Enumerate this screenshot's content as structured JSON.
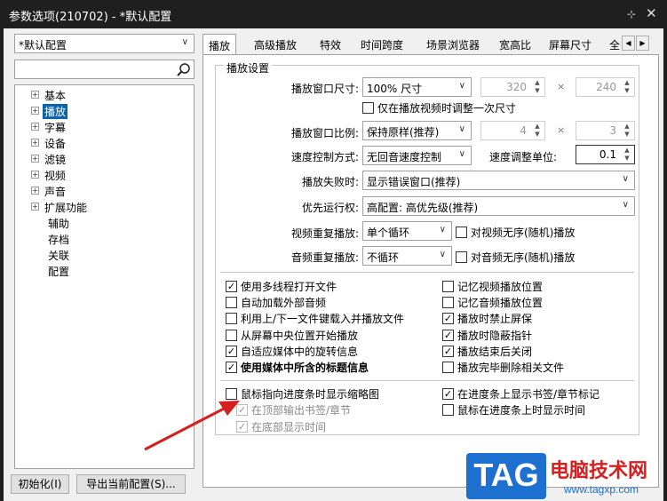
{
  "window": {
    "title": "参数选项(210702) - *默认配置",
    "pin_glyph": "⊹",
    "close_glyph": "✕"
  },
  "left": {
    "profile": "*默认配置",
    "search_placeholder": "",
    "tree": [
      {
        "label": "基本",
        "expandable": true
      },
      {
        "label": "播放",
        "expandable": true,
        "selected": true
      },
      {
        "label": "字幕",
        "expandable": true
      },
      {
        "label": "设备",
        "expandable": true
      },
      {
        "label": "滤镜",
        "expandable": true
      },
      {
        "label": "视频",
        "expandable": true
      },
      {
        "label": "声音",
        "expandable": true
      },
      {
        "label": "扩展功能",
        "expandable": true
      },
      {
        "label": "辅助",
        "expandable": false
      },
      {
        "label": "存档",
        "expandable": false
      },
      {
        "label": "关联",
        "expandable": false
      },
      {
        "label": "配置",
        "expandable": false
      }
    ]
  },
  "tabs": [
    "播放",
    "高级播放",
    "特效",
    "时间跨度",
    "场景浏览器",
    "宽高比",
    "屏幕尺寸",
    "全"
  ],
  "tab_scroll": {
    "left": "◀",
    "right": "▶"
  },
  "group": {
    "title": "播放设置",
    "window_size_label": "播放窗口尺寸:",
    "window_size_value": "100% 尺寸",
    "width_value": "320",
    "height_value": "240",
    "times": "×",
    "resize_once_label": "仅在播放视频时调整一次尺寸",
    "ratio_label": "播放窗口比例:",
    "ratio_value": "保持原样(推荐)",
    "ratio_w": "4",
    "ratio_h": "3",
    "speed_mode_label": "速度控制方式:",
    "speed_mode_value": "无回音速度控制",
    "speed_unit_label": "速度调整单位:",
    "speed_unit_value": "0.1",
    "fail_label": "播放失败时:",
    "fail_value": "显示错误窗口(推荐)",
    "priority_label": "优先运行权:",
    "priority_value": "高配置: 高优先级(推荐)",
    "video_repeat_label": "视频重复播放:",
    "video_repeat_value": "单个循环",
    "video_random_label": "对视频无序(随机)播放",
    "audio_repeat_label": "音频重复播放:",
    "audio_repeat_value": "不循环",
    "audio_random_label": "对音频无序(随机)播放"
  },
  "checks_left": [
    {
      "label": "使用多线程打开文件",
      "checked": true
    },
    {
      "label": "自动加载外部音频",
      "checked": false
    },
    {
      "label": "利用上/下一文件键载入并播放文件",
      "checked": false
    },
    {
      "label": "从屏幕中央位置开始播放",
      "checked": false
    },
    {
      "label": "自适应媒体中的旋转信息",
      "checked": true
    },
    {
      "label": "使用媒体中所含的标题信息",
      "checked": true
    }
  ],
  "checks_right": [
    {
      "label": "记忆视频播放位置",
      "checked": false
    },
    {
      "label": "记忆音频播放位置",
      "checked": false
    },
    {
      "label": "播放时禁止屏保",
      "checked": true
    },
    {
      "label": "播放时隐蔽指针",
      "checked": true
    },
    {
      "label": "播放结束后关闭",
      "checked": true
    },
    {
      "label": "播放完毕删除相关文件",
      "checked": false
    }
  ],
  "seek": {
    "thumb_label": "鼠标指向进度条时显示缩略图",
    "top_label": "在顶部输出书签/章节",
    "bottom_label": "在底部显示时间",
    "bookmarks_label": "在进度条上显示书签/章节标记",
    "time_label": "鼠标在进度条上时显示时间"
  },
  "buttons": {
    "init": "初始化(I)",
    "export": "导出当前配置(S)..."
  },
  "watermark": {
    "logo": "TAG",
    "name": "电脑技术网",
    "url": "www.tagxp.com"
  },
  "colors": {
    "accent": "#0a64ad",
    "arrow": "#d42020",
    "watermark_blue": "#1d6fd0"
  }
}
